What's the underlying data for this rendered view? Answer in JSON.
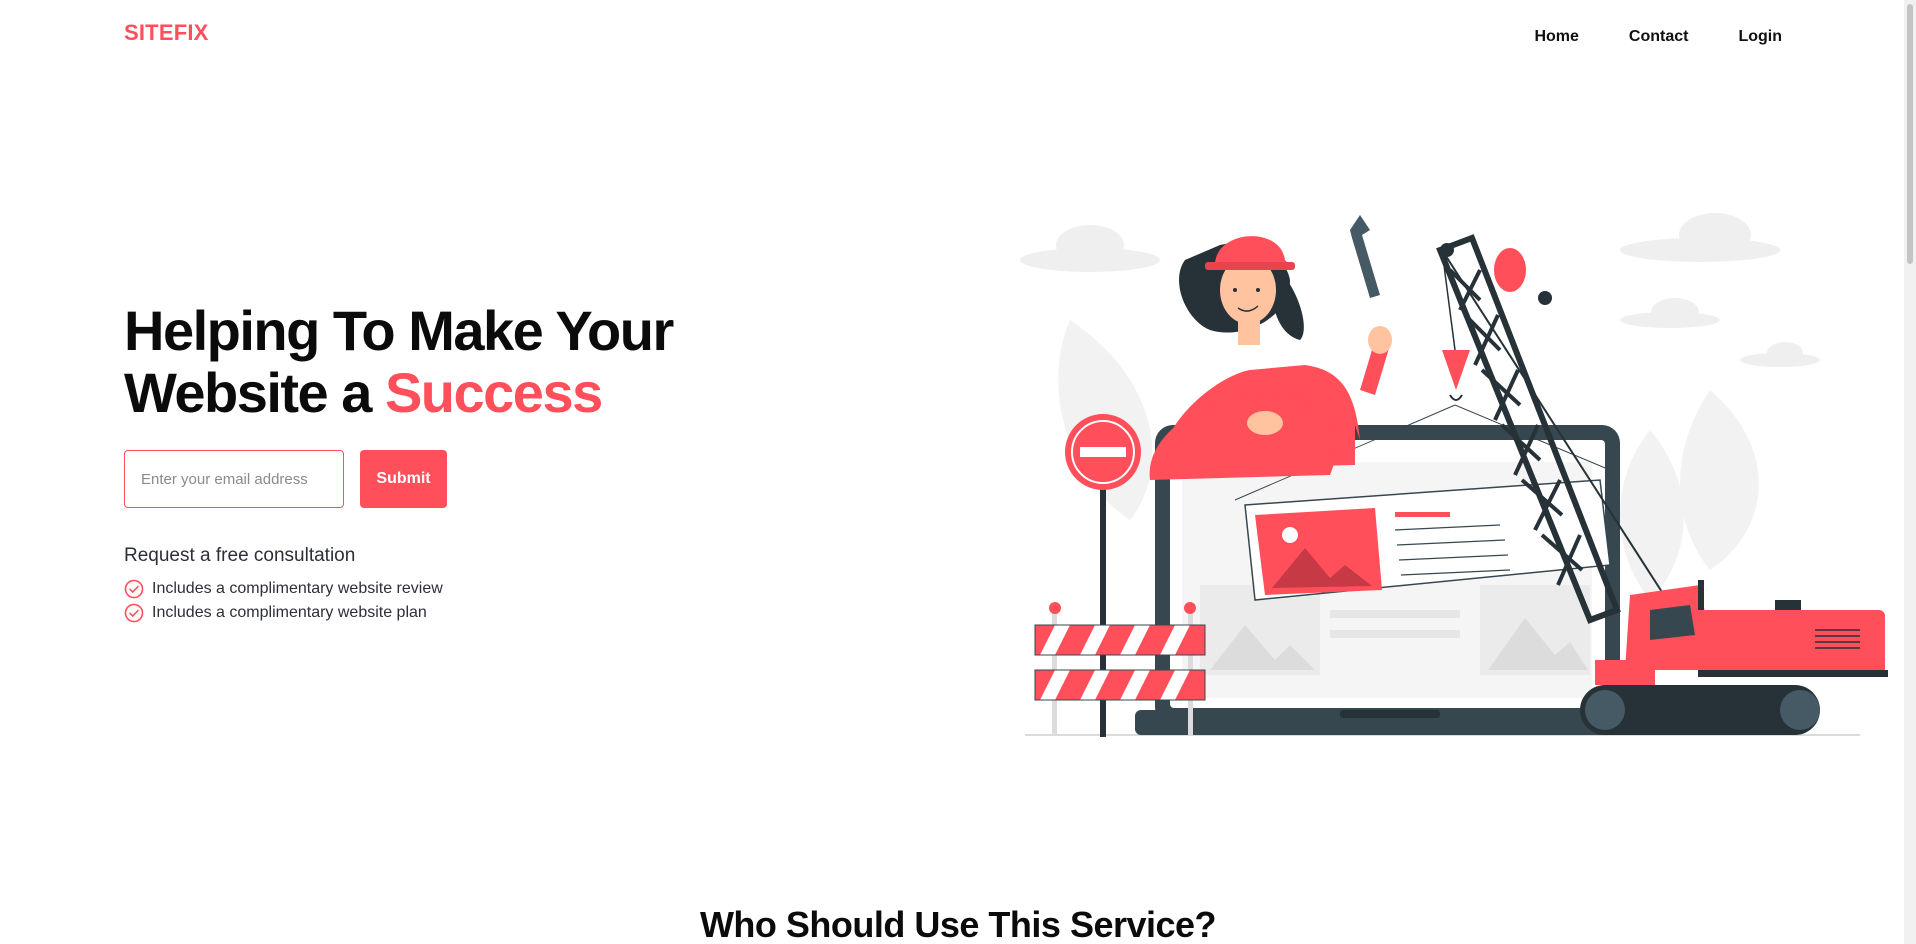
{
  "brand": "SITEFIX",
  "nav": {
    "home": "Home",
    "contact": "Contact",
    "login": "Login"
  },
  "hero": {
    "title_line1": "Helping To Make Your",
    "title_line2": "Website a ",
    "title_accent": "Success"
  },
  "signup": {
    "email_placeholder": "Enter your email address",
    "submit_label": "Submit"
  },
  "consult": {
    "title": "Request a free consultation",
    "features": [
      "Includes a complimentary website review",
      "Includes a complimentary website plan"
    ]
  },
  "section": {
    "title": "Who Should Use This Service?"
  },
  "colors": {
    "accent": "#ff4f5a",
    "dark": "#263238"
  },
  "icons": {
    "check": "check-circle-icon"
  }
}
